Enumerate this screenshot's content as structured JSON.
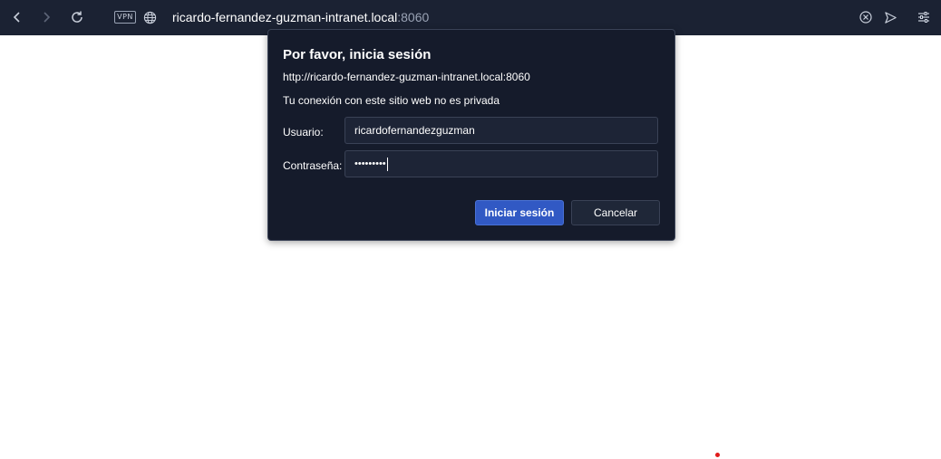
{
  "browser": {
    "vpn_label": "VPN",
    "url_host": "ricardo-fernandez-guzman-intranet.local",
    "url_port": ":8060",
    "icons": {
      "back": "chevron-left-icon",
      "forward": "chevron-right-icon",
      "reload": "reload-icon",
      "globe": "globe-icon",
      "close": "close-circle-icon",
      "send": "send-icon",
      "settings": "sliders-icon"
    }
  },
  "dialog": {
    "title": "Por favor, inicia sesión",
    "origin": "http://ricardo-fernandez-guzman-intranet.local:8060",
    "note": "Tu conexión con este sitio web no es privada",
    "username_label": "Usuario:",
    "username_value": "ricardofernandezguzman",
    "password_label": "Contraseña:",
    "password_value": "•••••••••",
    "submit_label": "Iniciar sesión",
    "cancel_label": "Cancelar"
  },
  "colors": {
    "toolbar_bg": "#1b2233",
    "dialog_bg": "#151b2b",
    "primary_button": "#3159c4",
    "marker_dot": "#e01b1b"
  }
}
